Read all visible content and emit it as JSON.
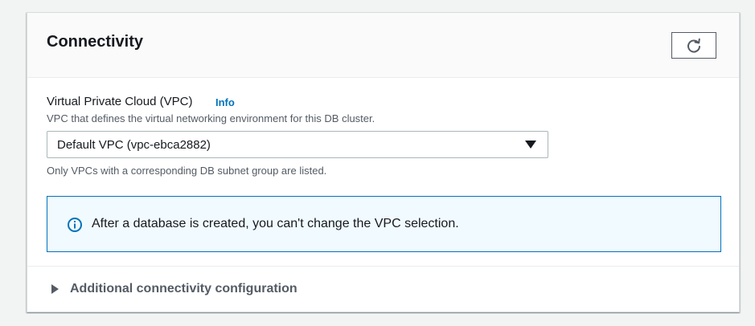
{
  "panel": {
    "title": "Connectivity",
    "refresh_icon": "refresh-icon"
  },
  "vpc": {
    "label": "Virtual Private Cloud (VPC)",
    "info_link": "Info",
    "description": "VPC that defines the virtual networking environment for this DB cluster.",
    "selected_value": "Default VPC (vpc-ebca2882)",
    "constraint": "Only VPCs with a corresponding DB subnet group are listed."
  },
  "alert": {
    "icon": "info-circle-icon",
    "text": "After a database is created, you can't change the VPC selection."
  },
  "additional": {
    "label": "Additional connectivity configuration",
    "expanded": false
  },
  "colors": {
    "link": "#0073bb",
    "alert_border": "#0073bb",
    "alert_background": "#f1faff",
    "header_background": "#fafafa"
  }
}
